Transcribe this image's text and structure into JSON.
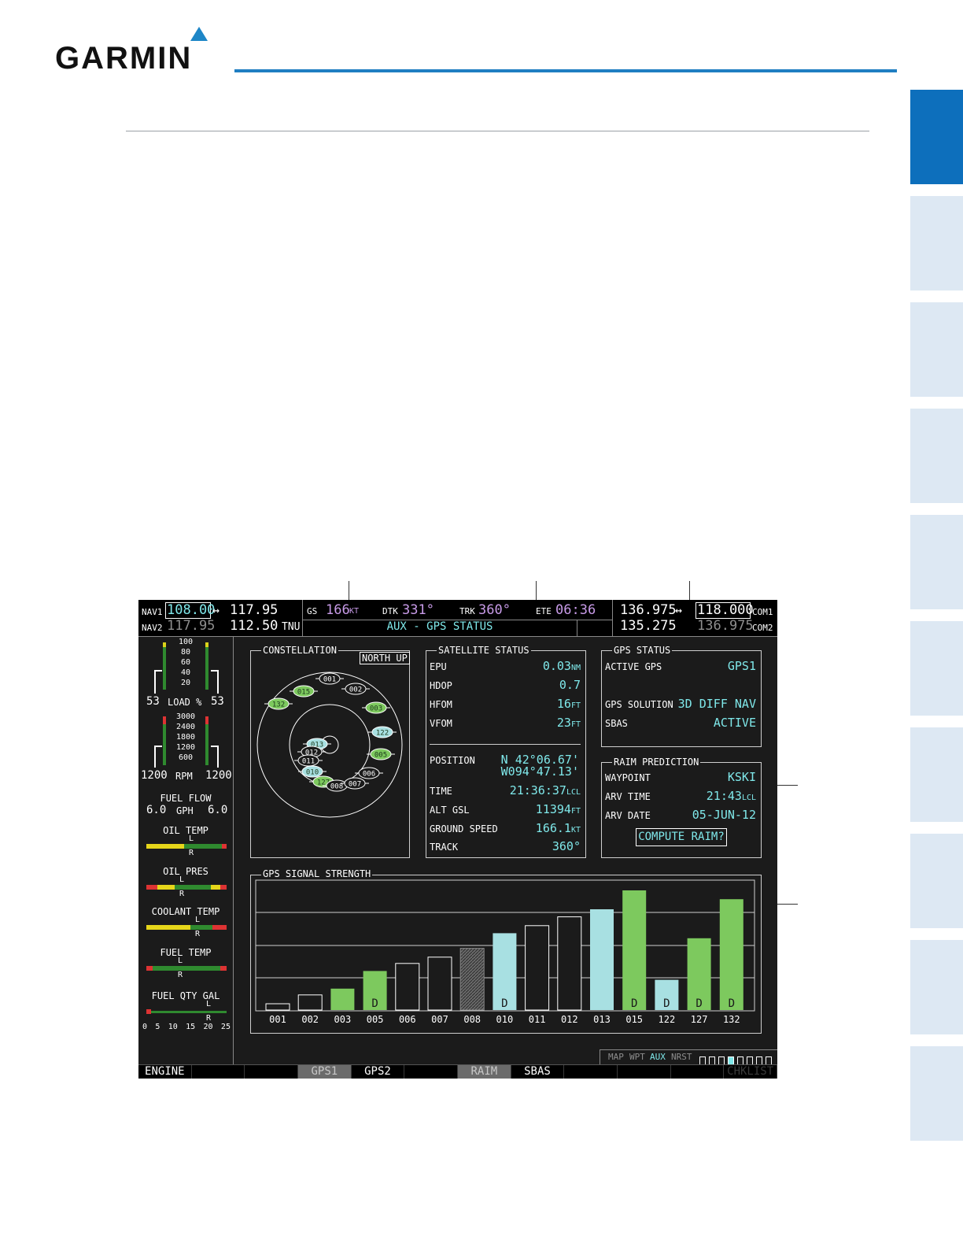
{
  "brand": {
    "logo_text": "GARMIN",
    "accent": "#1f7ec2"
  },
  "nav": {
    "nav1_label": "NAV1",
    "nav1_active": "108.00",
    "nav1_standby": "117.95",
    "nav2_label": "NAV2",
    "nav2_active": "117.95",
    "nav2_standby": "112.50",
    "nav2_ident": "TNU",
    "arrow": "↔"
  },
  "databar": {
    "gs_label": "GS",
    "gs_value": "166",
    "gs_unit": "KT",
    "dtk_label": "DTK",
    "dtk_value": "331°",
    "trk_label": "TRK",
    "trk_value": "360°",
    "ete_label": "ETE",
    "ete_value": "06:36",
    "page_title": "AUX - GPS STATUS"
  },
  "com": {
    "com1_label": "COM1",
    "com1_active": "136.975",
    "com1_standby": "118.000",
    "com2_label": "COM2",
    "com2_active": "135.275",
    "com2_standby": "136.975",
    "arrow": "↔"
  },
  "engine": {
    "load_scale": [
      "100",
      "80",
      "60",
      "40",
      "20"
    ],
    "load_left": "53",
    "load_label": "LOAD %",
    "load_right": "53",
    "rpm_scale": [
      "3000",
      "2400",
      "1800",
      "1200",
      "600"
    ],
    "rpm_left": "1200",
    "rpm_label": "RPM",
    "rpm_right": "1200",
    "fuel_flow_label": "FUEL FLOW",
    "ff_left": "6.0",
    "ff_unit": "GPH",
    "ff_right": "6.0",
    "oil_temp": "OIL TEMP",
    "oil_pres": "OIL PRES",
    "coolant_temp": "COOLANT TEMP",
    "fuel_temp": "FUEL TEMP",
    "fuel_qty": "FUEL QTY GAL",
    "fuel_qty_scale": [
      "0",
      "5",
      "10",
      "15",
      "20",
      "25"
    ],
    "left_marker": "L",
    "right_marker": "R"
  },
  "constellation": {
    "title": "CONSTELLATION",
    "orientation_button": "NORTH UP",
    "satellites": [
      {
        "id": "001",
        "fill": "none"
      },
      {
        "id": "002",
        "fill": "none"
      },
      {
        "id": "003",
        "fill": "green"
      },
      {
        "id": "015",
        "fill": "green"
      },
      {
        "id": "132",
        "fill": "green"
      },
      {
        "id": "122",
        "fill": "cyan"
      },
      {
        "id": "005",
        "fill": "green"
      },
      {
        "id": "013",
        "fill": "cyan"
      },
      {
        "id": "012",
        "fill": "none"
      },
      {
        "id": "011",
        "fill": "none"
      },
      {
        "id": "010",
        "fill": "cyan"
      },
      {
        "id": "006",
        "fill": "none"
      },
      {
        "id": "127",
        "fill": "green"
      },
      {
        "id": "008",
        "fill": "none"
      },
      {
        "id": "007",
        "fill": "none"
      }
    ]
  },
  "satellite_status": {
    "title": "SATELLITE STATUS",
    "epu_label": "EPU",
    "epu_value": "0.03",
    "epu_unit": "NM",
    "hdop_label": "HDOP",
    "hdop_value": "0.7",
    "hfom_label": "HFOM",
    "hfom_value": "16",
    "hfom_unit": "FT",
    "vfom_label": "VFOM",
    "vfom_value": "23",
    "vfom_unit": "FT",
    "position_label": "POSITION",
    "lat": "N 42°06.67'",
    "lon": "W094°47.13'",
    "time_label": "TIME",
    "time_value": "21:36:37",
    "time_unit": "LCL",
    "alt_label": "ALT GSL",
    "alt_value": "11394",
    "alt_unit": "FT",
    "gs_label": "GROUND SPEED",
    "gs_value": "166.1",
    "gs_unit": "KT",
    "track_label": "TRACK",
    "track_value": "360°"
  },
  "gps_status": {
    "title": "GPS STATUS",
    "active_label": "ACTIVE GPS",
    "active_value": "GPS1",
    "solution_label": "GPS SOLUTION",
    "solution_value": "3D DIFF NAV",
    "sbas_label": "SBAS",
    "sbas_value": "ACTIVE"
  },
  "raim": {
    "title": "RAIM PREDICTION",
    "waypoint_label": "WAYPOINT",
    "waypoint_value": "KSKI",
    "arv_time_label": "ARV TIME",
    "arv_time_value": "21:43",
    "arv_time_unit": "LCL",
    "arv_date_label": "ARV DATE",
    "arv_date_value": "05-JUN-12",
    "compute_button": "COMPUTE RAIM?"
  },
  "signal": {
    "title": "GPS SIGNAL STRENGTH",
    "colors": {
      "green": "#7dc95e",
      "cyan": "#a8e0e2",
      "outline": "#ffffff"
    }
  },
  "chart_data": {
    "type": "bar",
    "title": "GPS SIGNAL STRENGTH",
    "categories": [
      "001",
      "002",
      "003",
      "005",
      "006",
      "007",
      "008",
      "010",
      "011",
      "012",
      "013",
      "015",
      "122",
      "127",
      "132"
    ],
    "values": [
      0.05,
      0.12,
      0.17,
      0.31,
      0.37,
      0.42,
      0.49,
      0.61,
      0.67,
      0.74,
      0.8,
      0.95,
      0.24,
      0.57,
      0.88
    ],
    "styles": [
      "outline",
      "outline",
      "green",
      "green",
      "outline",
      "outline",
      "hatched",
      "cyan",
      "outline",
      "outline",
      "cyan",
      "green",
      "cyan",
      "green",
      "green"
    ],
    "differential": [
      "",
      "",
      "",
      "D",
      "",
      "",
      "",
      "D",
      "",
      "",
      "",
      "D",
      "D",
      "D",
      "D"
    ],
    "ylim": [
      0,
      1
    ]
  },
  "status_bar": {
    "groups": [
      "MAP",
      "WPT",
      "AUX",
      "NRST"
    ],
    "active_group": "AUX",
    "page_boxes": 8,
    "active_page": 3
  },
  "softkeys": [
    "ENGINE",
    "",
    "",
    "GPS1",
    "GPS2",
    "",
    "RAIM",
    "SBAS",
    "",
    "",
    "",
    "CHKLIST"
  ],
  "softkey_active": [
    false,
    false,
    false,
    true,
    false,
    false,
    true,
    false,
    false,
    false,
    false,
    false
  ]
}
